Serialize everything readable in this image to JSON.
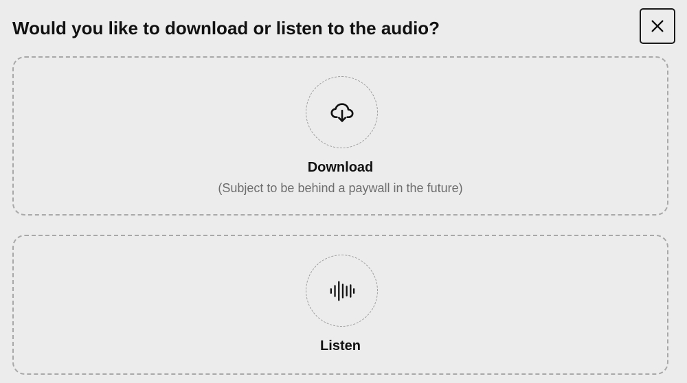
{
  "dialog": {
    "title": "Would you like to download or listen to the audio?",
    "close_icon": "close-icon"
  },
  "options": [
    {
      "label": "Download",
      "subtitle": "(Subject to be behind a paywall in the future)",
      "icon": "cloud-download-icon"
    },
    {
      "label": "Listen",
      "icon": "audio-waveform-icon"
    }
  ],
  "colors": {
    "background": "#ececec",
    "border": "#a8a8a8",
    "text": "#111111",
    "muted_text": "#6d6d6d"
  }
}
